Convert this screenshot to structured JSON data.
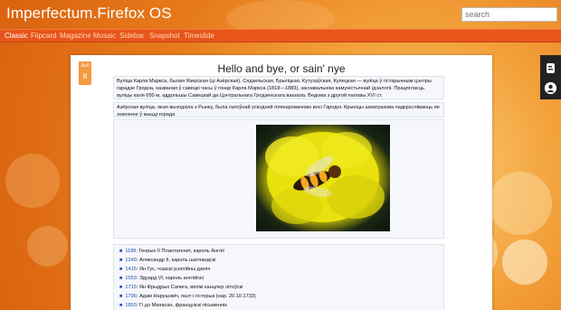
{
  "header": {
    "title": "Imperfectum.Firefox OS"
  },
  "search": {
    "placeholder": "search"
  },
  "nav": {
    "items": [
      "Classic",
      "Flipcard",
      "Magazine",
      "Mosaic",
      "Sidebar",
      "Snapshot",
      "Timeslide"
    ]
  },
  "post": {
    "date_month": "Jun",
    "date_day": "8",
    "title": "Hello and bye, or sain' nye",
    "intro_text": "Вуліца Карла Маркса, былая Язерская (ці Азёрская), Сядзельская, Брыгіцкая, Кутузаўская, Кулецкая — вуліца ў гістарычным цэнтры гарадзе Гродна, названая ў савецкі часы ў гонар Карла Маркса (1818—1883), заснавальніка камуністычнай ідэалогіі. Працягласць вуліцы каля 650 м, аддольшы Савецкай да Цэнтральнага Гродзенскага вакзала. Ведома з другой паловы XVI ст.",
    "second_text": "Азёрская вуліца, якая выходзіла з Рынку, была галоўнай ускодняй плянаровачнаю восі Гародні. Крыніцы шматразова падкрэсліваюць яе значэнне ў жыцці горада",
    "events": [
      {
        "year": "1189",
        "text": "Генрых II Плантагенет, кароль Англіі"
      },
      {
        "year": "1249",
        "text": "Аляксандр II, кароль шатландскі"
      },
      {
        "year": "1415",
        "text": "Ян Гус, чэшскі рэлігійны дзеяч"
      },
      {
        "year": "1553",
        "text": "Эдуард VI, кароль англійскі"
      },
      {
        "year": "1715",
        "text": "Ян Фрыдрых Сапега, вялікі канцлер літоўскі"
      },
      {
        "year": "1796",
        "text": "Адам Нарушэвіч, паэт і гісторык (нар. 20.10.1733)"
      },
      {
        "year": "1893",
        "text": "Гі дэ Мапасан, французскі пісьменнік"
      }
    ]
  }
}
